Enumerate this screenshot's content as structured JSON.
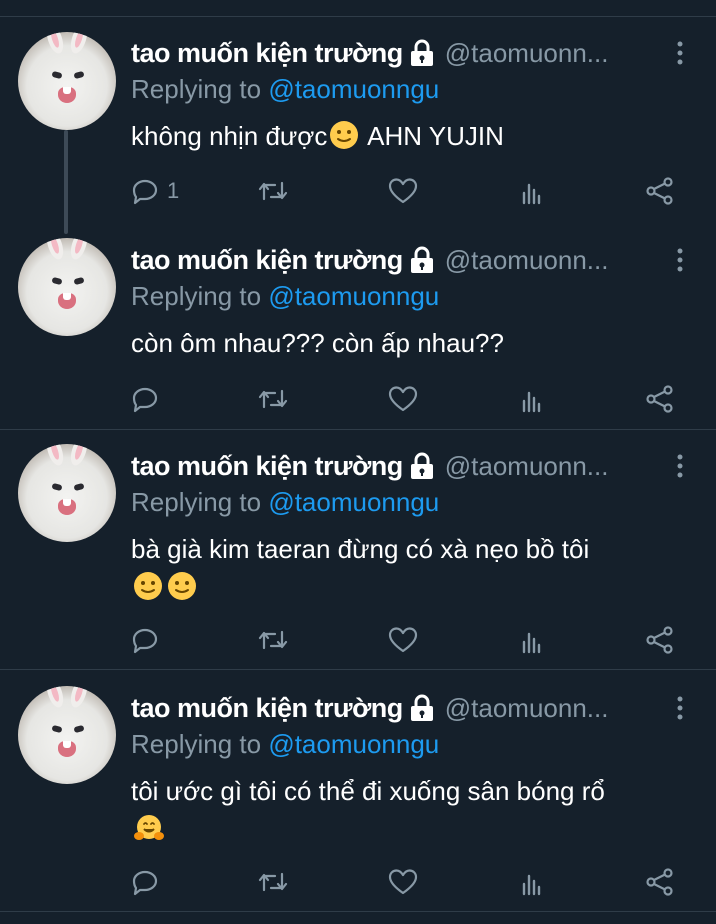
{
  "tweets": [
    {
      "author": "tao muốn kiện trường",
      "handle": "@taomuonn...",
      "replying_prefix": "Replying to",
      "replying_to": "@taomuonngu",
      "text": "không nhịn được",
      "text_after_emoji": " AHN YUJIN",
      "emojis": [
        "slightly-smiling-face"
      ],
      "reply_count": "1"
    },
    {
      "author": "tao muốn kiện trường",
      "handle": "@taomuonn...",
      "replying_prefix": "Replying to",
      "replying_to": "@taomuonngu",
      "text": "còn ôm nhau??? còn ấp nhau??",
      "reply_count": ""
    },
    {
      "author": "tao muốn kiện trường",
      "handle": "@taomuonn...",
      "replying_prefix": "Replying to",
      "replying_to": "@taomuonngu",
      "text": "bà già kim taeran đừng có xà nẹo bồ tôi",
      "emojis": [
        "slightly-smiling-face",
        "slightly-smiling-face"
      ],
      "reply_count": ""
    },
    {
      "author": "tao muốn kiện trường",
      "handle": "@taomuonn...",
      "replying_prefix": "Replying to",
      "replying_to": "@taomuonngu",
      "text": "tôi ước gì tôi có thể đi xuống sân bóng rổ",
      "emojis": [
        "hugging-face"
      ],
      "reply_count": ""
    }
  ],
  "icons": {
    "lock": "lock-icon",
    "more": "more-vertical-icon",
    "reply": "reply-icon",
    "retweet": "retweet-icon",
    "like": "heart-icon",
    "analytics": "analytics-icon",
    "share": "share-icon"
  },
  "colors": {
    "background": "#15202b",
    "text": "#ffffff",
    "secondary": "#8899a6",
    "mention": "#1d9bf0",
    "divider": "#2f3c48"
  }
}
